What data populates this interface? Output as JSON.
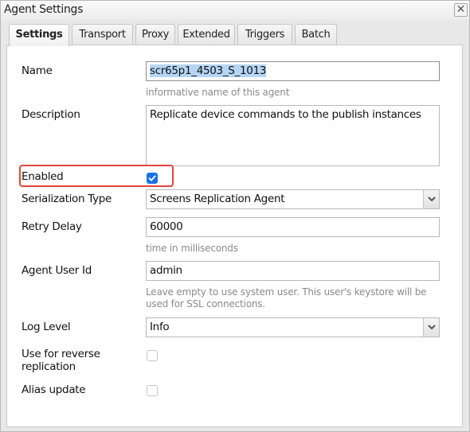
{
  "window": {
    "title": "Agent Settings",
    "close_icon": "close-x-icon"
  },
  "tabs": [
    {
      "label": "Settings",
      "active": true
    },
    {
      "label": "Transport",
      "active": false
    },
    {
      "label": "Proxy",
      "active": false
    },
    {
      "label": "Extended",
      "active": false
    },
    {
      "label": "Triggers",
      "active": false
    },
    {
      "label": "Batch",
      "active": false
    }
  ],
  "form": {
    "name": {
      "label": "Name",
      "value": "scr65p1_4503_S_1013",
      "hint": "informative name of this agent"
    },
    "description": {
      "label": "Description",
      "value": "Replicate device commands to the publish instances"
    },
    "enabled": {
      "label": "Enabled",
      "checked": true
    },
    "serialization_type": {
      "label": "Serialization Type",
      "selected": "Screens Replication Agent"
    },
    "retry_delay": {
      "label": "Retry Delay",
      "value": "60000",
      "hint": "time in milliseconds"
    },
    "agent_user_id": {
      "label": "Agent User Id",
      "value": "admin",
      "hint": "Leave empty to use system user. This user's keystore will be used for SSL connections."
    },
    "log_level": {
      "label": "Log Level",
      "selected": "Info"
    },
    "reverse_replication": {
      "label": "Use for reverse replication",
      "checked": false
    },
    "alias_update": {
      "label": "Alias update",
      "checked": false
    }
  },
  "annotation": {
    "highlight_color": "#e0473b",
    "highlighted_field": "Enabled"
  },
  "colors": {
    "checkbox_checked": "#1a73e8",
    "selection_highlight": "#b5d5f5",
    "hint_text": "#8a8a8a"
  }
}
